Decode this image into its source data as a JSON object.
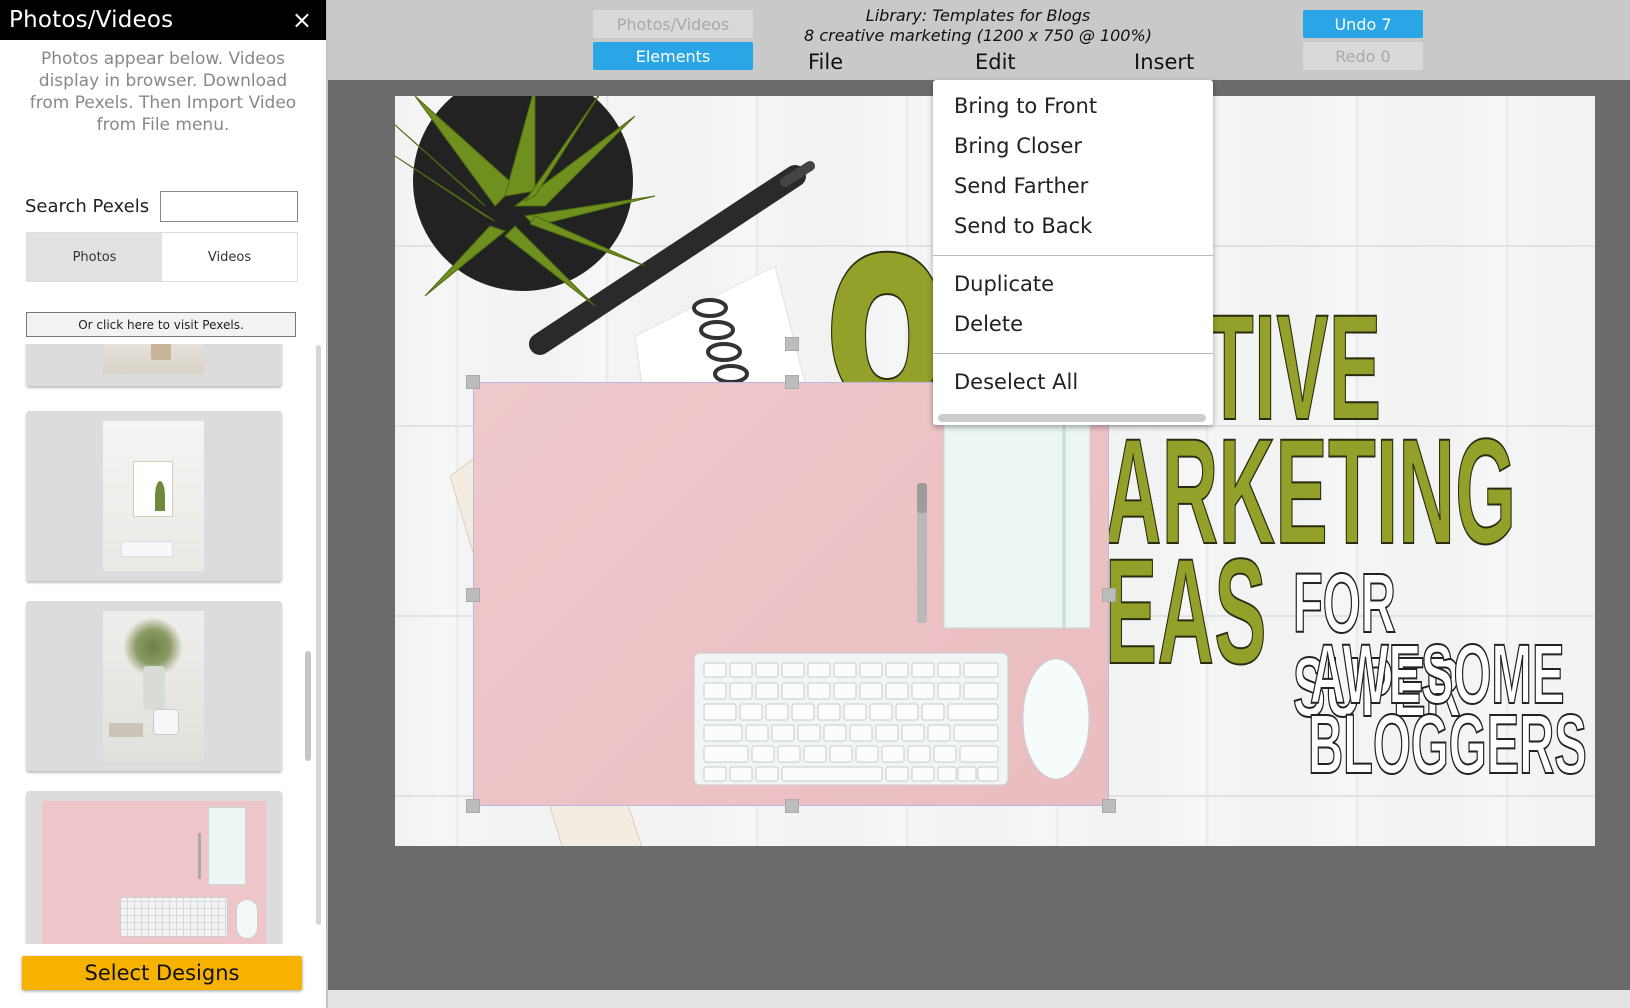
{
  "sidebar": {
    "title": "Photos/Videos",
    "close_symbol": "×",
    "info_text": "Photos appear below. Videos display in browser. Download from Pexels. Then Import Video from File menu.",
    "search_label": "Search Pexels",
    "search_value": "",
    "search_placeholder": "",
    "tabs": [
      {
        "label": "Photos",
        "active": true
      },
      {
        "label": "Videos",
        "active": false
      }
    ],
    "visit_pexels_label": "Or click here to visit Pexels.",
    "select_designs_label": "Select Designs"
  },
  "toolbar": {
    "photos_videos_label": "Photos/Videos",
    "elements_label": "Elements",
    "doc_title_line1": "Library: Templates for Blogs",
    "doc_title_line2": "8 creative marketing  (1200 x 750 @ 100%)",
    "undo_label": "Undo 7",
    "redo_label": "Redo 0",
    "menu_file": "File",
    "menu_edit": "Edit",
    "menu_insert": "Insert",
    "accent_color": "#2aa6e6"
  },
  "edit_menu": {
    "items": [
      {
        "label": "Bring to Front"
      },
      {
        "label": "Bring Closer"
      },
      {
        "label": "Send Farther"
      },
      {
        "label": "Send to Back"
      },
      {
        "label": "Duplicate"
      },
      {
        "label": "Delete"
      },
      {
        "label": "Deselect All"
      }
    ]
  },
  "canvas": {
    "big_number": "8",
    "headline_1": "ATIVE",
    "headline_2": "ARKETING",
    "headline_3": "EAS",
    "subline_1": "FOR SUPER",
    "subline_2": "AWESOME",
    "subline_3": "BLOGGERS",
    "headline_color": "#93a02a"
  }
}
